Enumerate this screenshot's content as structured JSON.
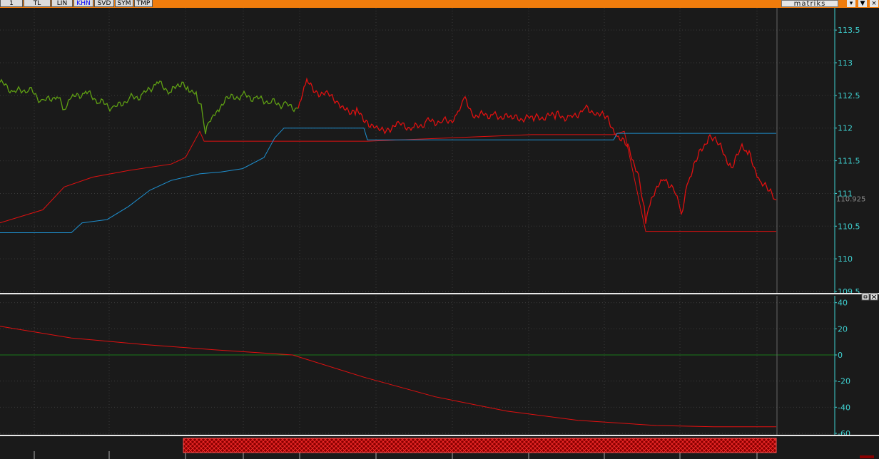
{
  "toolbar": {
    "tabs": [
      {
        "label": "1",
        "active": false
      },
      {
        "label": "TL",
        "active": false
      },
      {
        "label": "LIN",
        "active": false
      },
      {
        "label": "KHN",
        "active": true
      },
      {
        "label": "SVD",
        "active": false
      },
      {
        "label": "SYM",
        "active": false
      },
      {
        "label": "TMP",
        "active": false
      }
    ],
    "brand": "matriks",
    "colors": {
      "bar": "#f07c0c",
      "tab": "#dcdcdc",
      "active_tab_text": "#0000ff"
    }
  },
  "chart_data": [
    {
      "type": "line",
      "y_ticks": [
        "113.5",
        "113",
        "112.5",
        "112",
        "111.5",
        "111",
        "110.5",
        "110",
        "109.5"
      ],
      "ylim": [
        109.5,
        113.6
      ],
      "last_value": "110.925",
      "series": [
        {
          "color": "#5fa013",
          "x": [
            0,
            20,
            40,
            60,
            80,
            90,
            100,
            120,
            140,
            160,
            180,
            200,
            220,
            240,
            255,
            265,
            275,
            282,
            288,
            295,
            305,
            320,
            340,
            360,
            380,
            400,
            418
          ],
          "y": [
            112.7,
            112.55,
            112.6,
            112.4,
            112.5,
            112.25,
            112.45,
            112.55,
            112.4,
            112.3,
            112.45,
            112.5,
            112.7,
            112.55,
            112.72,
            112.6,
            112.55,
            112.3,
            111.95,
            112.15,
            112.3,
            112.45,
            112.5,
            112.45,
            112.4,
            112.35,
            112.3
          ]
        },
        {
          "color": "#e01010",
          "x": [
            418,
            430,
            445,
            460,
            475,
            490,
            500,
            515,
            530,
            545,
            560,
            580,
            600,
            620,
            640,
            650,
            665,
            690,
            720,
            750,
            780,
            800,
            820,
            835,
            850,
            865,
            880,
            895,
            905,
            915,
            930,
            945,
            955,
            965,
            980,
            995,
            1010,
            1025,
            1040,
            1050,
            1065,
            1080,
            1088
          ],
          "y": [
            112.3,
            112.7,
            112.55,
            112.5,
            112.4,
            112.2,
            112.25,
            112.1,
            111.95,
            112.0,
            112.05,
            112.0,
            112.1,
            112.1,
            112.15,
            112.45,
            112.2,
            112.2,
            112.15,
            112.15,
            112.2,
            112.15,
            112.3,
            112.25,
            112.15,
            111.9,
            111.7,
            111.3,
            110.6,
            111.0,
            111.2,
            111.1,
            110.7,
            111.2,
            111.6,
            111.9,
            111.7,
            111.4,
            111.7,
            111.6,
            111.2,
            111.0,
            110.9
          ]
        },
        {
          "color": "#e01010",
          "x": [
            0,
            60,
            90,
            130,
            180,
            240,
            260,
            280,
            286,
            420,
            515,
            745,
            860,
            875,
            905,
            1088
          ],
          "y": [
            110.55,
            110.75,
            111.1,
            111.25,
            111.35,
            111.45,
            111.55,
            111.95,
            111.8,
            111.8,
            111.8,
            111.9,
            111.9,
            111.95,
            110.42,
            110.42
          ]
        },
        {
          "color": "#1e90d0",
          "x": [
            0,
            100,
            115,
            150,
            180,
            210,
            240,
            280,
            310,
            340,
            370,
            385,
            398,
            420,
            510,
            515,
            745,
            860,
            865,
            1088
          ],
          "y": [
            110.4,
            110.4,
            110.55,
            110.6,
            110.8,
            111.05,
            111.2,
            111.3,
            111.33,
            111.38,
            111.55,
            111.85,
            112.0,
            112.0,
            112.0,
            111.82,
            111.82,
            111.82,
            111.92,
            111.92
          ]
        }
      ]
    },
    {
      "type": "line",
      "y_ticks": [
        "40",
        "20",
        "0",
        "-20",
        "-40",
        "-60"
      ],
      "ylim": [
        -60,
        42
      ],
      "series": [
        {
          "color": "#e01010",
          "x": [
            0,
            100,
            200,
            300,
            410,
            510,
            610,
            710,
            810,
            920,
            1000,
            1088
          ],
          "y": [
            22,
            13,
            8,
            4,
            0,
            -17,
            -32,
            -43,
            -50,
            -54,
            -55,
            -55
          ]
        }
      ]
    }
  ]
}
